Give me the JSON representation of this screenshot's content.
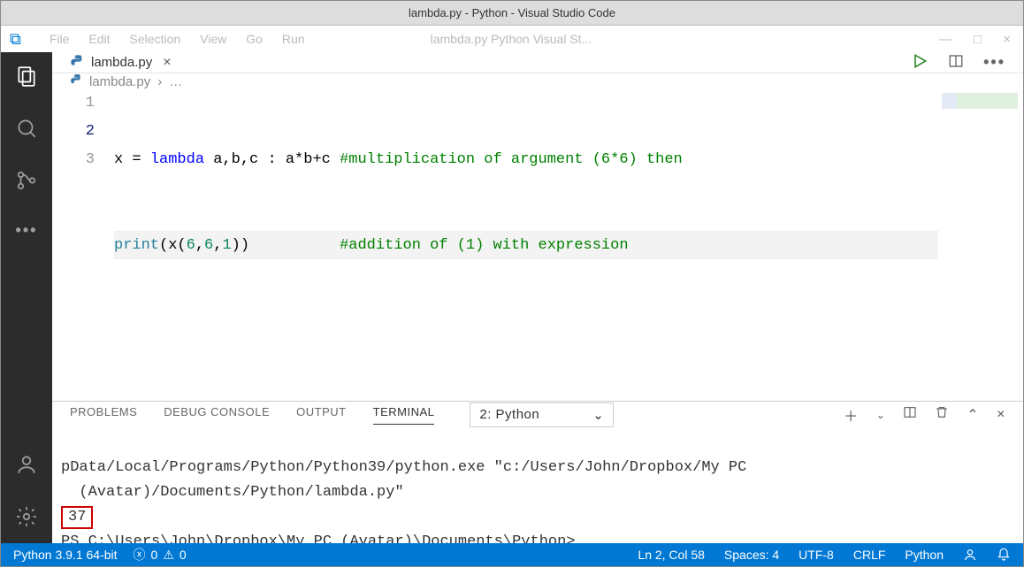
{
  "titlebar": {
    "title": "lambda.py - Python - Visual Studio Code"
  },
  "menubar": {
    "items": [
      "File",
      "Edit",
      "Selection",
      "View",
      "Go",
      "Run"
    ],
    "truncated": "lambda.py   Python   Visual St...",
    "right_min": "—",
    "right_max": "□",
    "right_close": "×"
  },
  "tab": {
    "filename": "lambda.py"
  },
  "breadcrumb": {
    "filename": "lambda.py",
    "sep": "›",
    "more": "…"
  },
  "editor": {
    "lines": [
      "1",
      "2",
      "3"
    ],
    "l1": {
      "a": "x = ",
      "kw": "lambda",
      "b": " a,b,c : a*b+c ",
      "com": "#multiplication of argument (6*6) then"
    },
    "l2": {
      "fn": "print",
      "mid": "(x(",
      "n1": "6",
      "c": ",",
      "n2": "6",
      "n3": "1",
      "end": "))",
      "pad": "          ",
      "com": "#addition of (1) with expression"
    }
  },
  "panel": {
    "tabs": {
      "problems": "PROBLEMS",
      "debug": "DEBUG CONSOLE",
      "output": "OUTPUT",
      "terminal": "TERMINAL"
    },
    "select": "2: Python",
    "line1": "pData/Local/Programs/Python/Python39/python.exe \"c:/Users/John/Dropbox/My PC",
    "line2": "  (Avatar)/Documents/Python/lambda.py\"",
    "result": "37",
    "prompt": "PS C:\\Users\\John\\Dropbox\\My PC (Avatar)\\Documents\\Python>"
  },
  "status": {
    "python": "Python 3.9.1 64-bit",
    "errors": "0",
    "warnings": "0",
    "cursor": "Ln 2, Col 58",
    "spaces": "Spaces: 4",
    "encoding": "UTF-8",
    "eol": "CRLF",
    "lang": "Python"
  }
}
